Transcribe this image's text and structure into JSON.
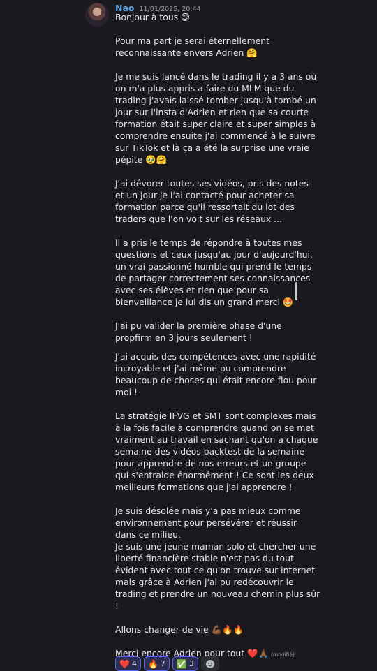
{
  "message": {
    "username": "Nao",
    "timestamp": "11/01/2025, 20:44",
    "paragraphs": [
      [
        "Bonjour à tous 😊"
      ],
      [
        "Pour ma part je serai éternellement",
        "reconnaissante envers Adrien 🤗"
      ],
      [
        "Je me suis lancé dans le trading il y a 3 ans où",
        "on m'a plus appris a faire du MLM que du",
        "trading j'avais laissé tomber jusqu'à tombé un",
        "jour sur l'insta d'Adrien et rien que sa courte",
        "formation était super claire et super simples à",
        "comprendre ensuite j'ai commencé à le suivre",
        "sur TikTok et là ça a été la surprise une vraie",
        "pépite 🥹🤗"
      ],
      [
        "J'ai dévorer toutes ses vidéos, pris des notes",
        "et un jour je l'ai contacté pour acheter sa",
        "formation parce qu'il ressortait du lot des",
        "traders que l'on voit sur les réseaux ..."
      ],
      [
        "Il a pris le temps de répondre à toutes mes",
        "questions et ceux jusqu'au jour d'aujourd'hui,",
        "un vrai passionné humble qui prend le temps",
        "de partager correctement ses connaissances",
        "avec ses élèves et rien que pour sa",
        "bienveillance je lui dis un grand merci 🤩"
      ],
      [
        "J'ai pu valider la première phase d'une",
        "propfirm en 3 jours seulement !"
      ],
      [
        "J'ai acquis des compétences avec une rapidité",
        "incroyable et j'ai même pu comprendre",
        "beaucoup de choses qui était encore flou pour",
        "moi !"
      ],
      [
        "La stratégie IFVG et SMT sont complexes mais",
        "à la fois facile à comprendre quand on se met",
        "vraiment au travail en sachant qu'on a chaque",
        "semaine des vidéos backtest de la semaine",
        "pour apprendre de nos erreurs et un groupe",
        "qui s'entraide énormément ! Ce sont les deux",
        "meilleurs formations que j'ai apprendre !"
      ],
      [
        "Je suis désolée mais y'a pas mieux comme",
        "environnement pour persévérer et réussir",
        "dans ce milieu.",
        "Je suis une jeune maman solo et chercher une",
        "liberté financière stable n'est pas du tout",
        "évident avec tout ce qu'on trouve sur internet",
        "mais grâce à Adrien j'ai pu redécouvrir le",
        "trading et prendre un nouveau chemin plus sûr",
        "!"
      ],
      [
        "Allons changer de vie 💪🏾🔥🔥"
      ]
    ],
    "last_line": "Merci encore Adrien pour tout ❤️🙏🏾",
    "edited_label": "(modifié)"
  },
  "reactions": [
    {
      "emoji": "❤️",
      "count": "4"
    },
    {
      "emoji": "🔥",
      "count": "7"
    },
    {
      "emoji": "✅",
      "count": "3"
    }
  ],
  "add_reaction_icon": "smiley-add-icon"
}
